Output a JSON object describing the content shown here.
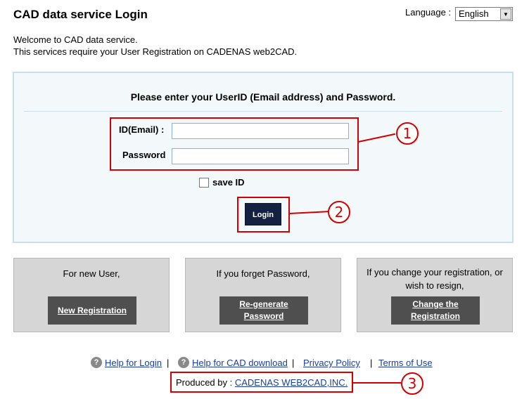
{
  "page": {
    "title": "CAD data service Login",
    "language_label": "Language :",
    "language_value": "English",
    "welcome_line1": "Welcome to CAD data service.",
    "welcome_line2": "This services require your User Registration on CADENAS web2CAD."
  },
  "login": {
    "heading": "Please enter your UserID (Email address) and Password.",
    "id_label": "ID(Email) :",
    "id_value": "",
    "password_label": "Password",
    "password_value": "",
    "save_id_label": "save ID",
    "save_id_checked": false,
    "login_button": "Login"
  },
  "callouts": [
    "1",
    "2",
    "3"
  ],
  "cards": [
    {
      "text": "For new User,",
      "button": "New Registration"
    },
    {
      "text": "If you forget Password,",
      "button_line1": "Re-generate",
      "button_line2": "Password"
    },
    {
      "text_line1": "If you change your registration, or",
      "text_line2": "wish to resign,",
      "button_line1": "Change the",
      "button_line2": "Registration"
    }
  ],
  "footer": {
    "help_login": "Help for Login",
    "help_cad": "Help for CAD download",
    "privacy": "Privacy Policy",
    "terms": "Terms of Use",
    "separator": "|",
    "produced_by": "Produced by :",
    "company": "CADENAS WEB2CAD,INC."
  },
  "icons": {
    "help": "question-circle-icon",
    "dropdown": "chevron-down-icon"
  },
  "colors": {
    "accent_red": "#d20000",
    "login_button": "#142141",
    "link": "#1a3f9e",
    "panel_bg": "#f3f8fb"
  }
}
